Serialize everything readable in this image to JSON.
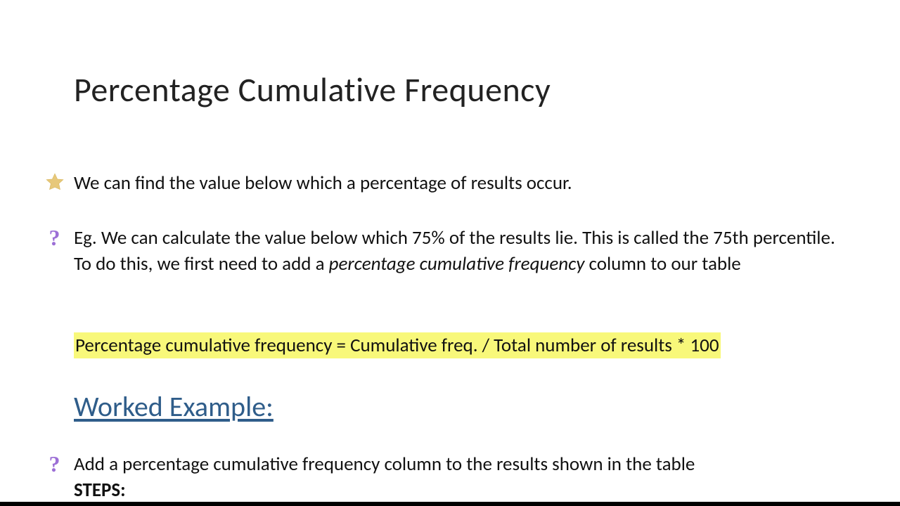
{
  "title": "Percentage Cumulative Frequency",
  "line1": "We can find the value below which a percentage of results occur.",
  "line2a": "Eg. We can calculate the value below which 75% of the results lie. This is called the 75th percentile.",
  "line2b_pre": "To do this, we first need to add a ",
  "line2b_italic": "percentage cumulative frequency",
  "line2b_post": " column to our table",
  "formula": "Percentage cumulative frequency = Cumulative freq. / Total number of results * 100",
  "worked_heading": "Worked Example:",
  "line5": "Add a percentage cumulative frequency column to the results shown in the table",
  "steps_label": "STEPS:",
  "icons": {
    "star": "star-icon",
    "question": "question-icon"
  },
  "colors": {
    "highlight": "#f8f87a",
    "heading_blue": "#2f5d8a",
    "question_purple": "#9c6fd6",
    "star_fill": "#e7c87a"
  }
}
